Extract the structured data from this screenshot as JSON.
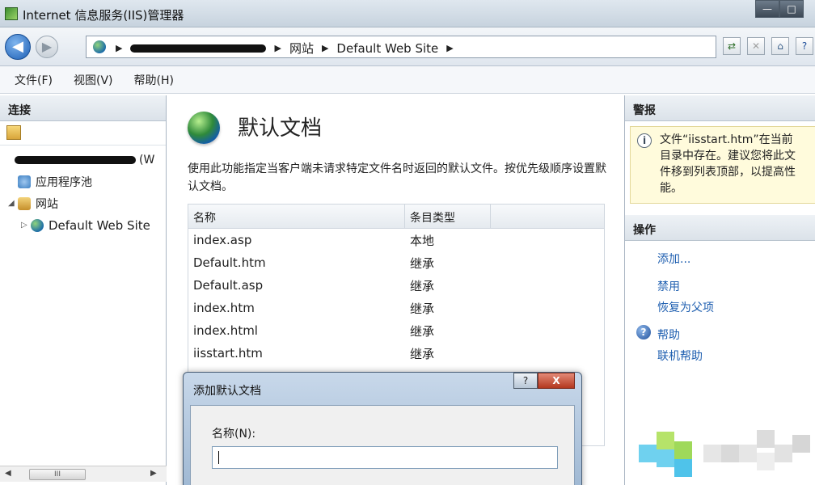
{
  "window": {
    "title": "Internet 信息服务(IIS)管理器",
    "minimize_glyph": "—",
    "maximize_glyph": "□"
  },
  "address": {
    "crumbs": [
      "网站",
      "Default Web Site"
    ],
    "sep": "▶"
  },
  "menu": [
    "文件(F)",
    "视图(V)",
    "帮助(H)"
  ],
  "connections": {
    "title": "连接",
    "server_suffix": "(W",
    "tree": [
      {
        "label": "应用程序池"
      },
      {
        "label": "网站"
      },
      {
        "label": "Default Web Site"
      }
    ],
    "scroll_thumb": "III"
  },
  "feature": {
    "title": "默认文档",
    "description": "使用此功能指定当客户端未请求特定文件名时返回的默认文件。按优先级顺序设置默认文档。",
    "columns": [
      "名称",
      "条目类型"
    ],
    "rows": [
      {
        "name": "index.asp",
        "type": "本地"
      },
      {
        "name": "Default.htm",
        "type": "继承"
      },
      {
        "name": "Default.asp",
        "type": "继承"
      },
      {
        "name": "index.htm",
        "type": "继承"
      },
      {
        "name": "index.html",
        "type": "继承"
      },
      {
        "name": "iisstart.htm",
        "type": "继承"
      }
    ]
  },
  "dialog": {
    "title": "添加默认文档",
    "help_glyph": "?",
    "close_glyph": "X",
    "name_label": "名称(N):",
    "name_value": ""
  },
  "alerts": {
    "title": "警报",
    "lines": [
      "文件“iisstart.htm”在当前",
      "目录中存在。建议您将此文",
      "件移到列表顶部，以提高性",
      "能。"
    ],
    "info_glyph": "i"
  },
  "actions": {
    "title": "操作",
    "add": "添加...",
    "disable": "禁用",
    "revert": "恢复为父项",
    "help": "帮助",
    "online_help": "联机帮助",
    "help_glyph": "?"
  }
}
